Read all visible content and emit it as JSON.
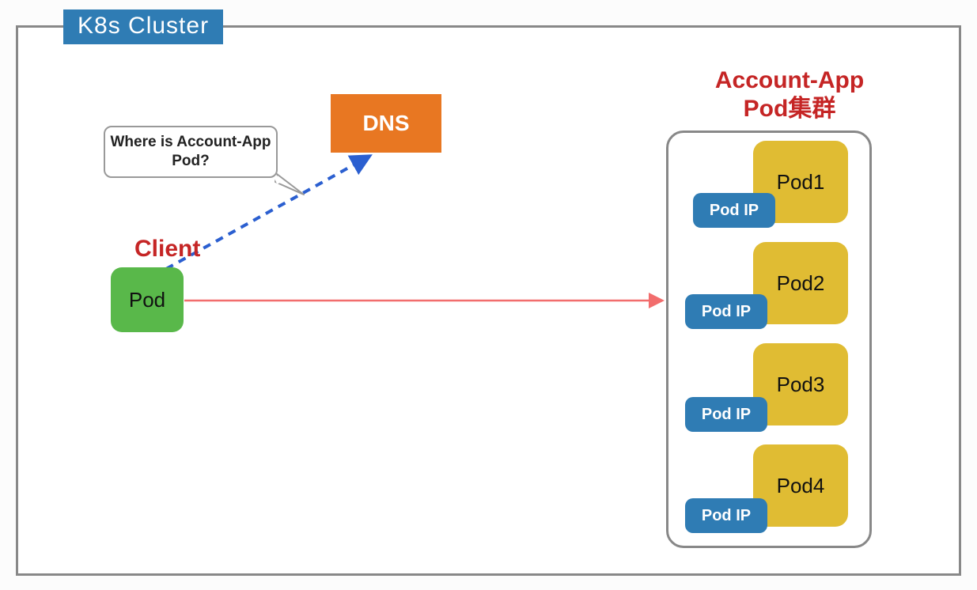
{
  "cluster": {
    "label": "K8s Cluster"
  },
  "dns": {
    "label": "DNS"
  },
  "speech": {
    "text": "Where is Account-App Pod?"
  },
  "client": {
    "label": "Client",
    "pod_label": "Pod"
  },
  "group": {
    "title_line1": "Account-App",
    "title_line2": "Pod集群"
  },
  "pods": [
    {
      "name": "Pod1",
      "ip_label": "Pod IP"
    },
    {
      "name": "Pod2",
      "ip_label": "Pod IP"
    },
    {
      "name": "Pod3",
      "ip_label": "Pod IP"
    },
    {
      "name": "Pod4",
      "ip_label": "Pod IP"
    }
  ],
  "colors": {
    "blue": "#2f7cb4",
    "orange": "#e87722",
    "green": "#59b84a",
    "yellow": "#e0bc33",
    "red": "#c52525",
    "gray": "#888888",
    "arrow_red": "#f26d6d",
    "arrow_blue": "#2b5fd0"
  }
}
